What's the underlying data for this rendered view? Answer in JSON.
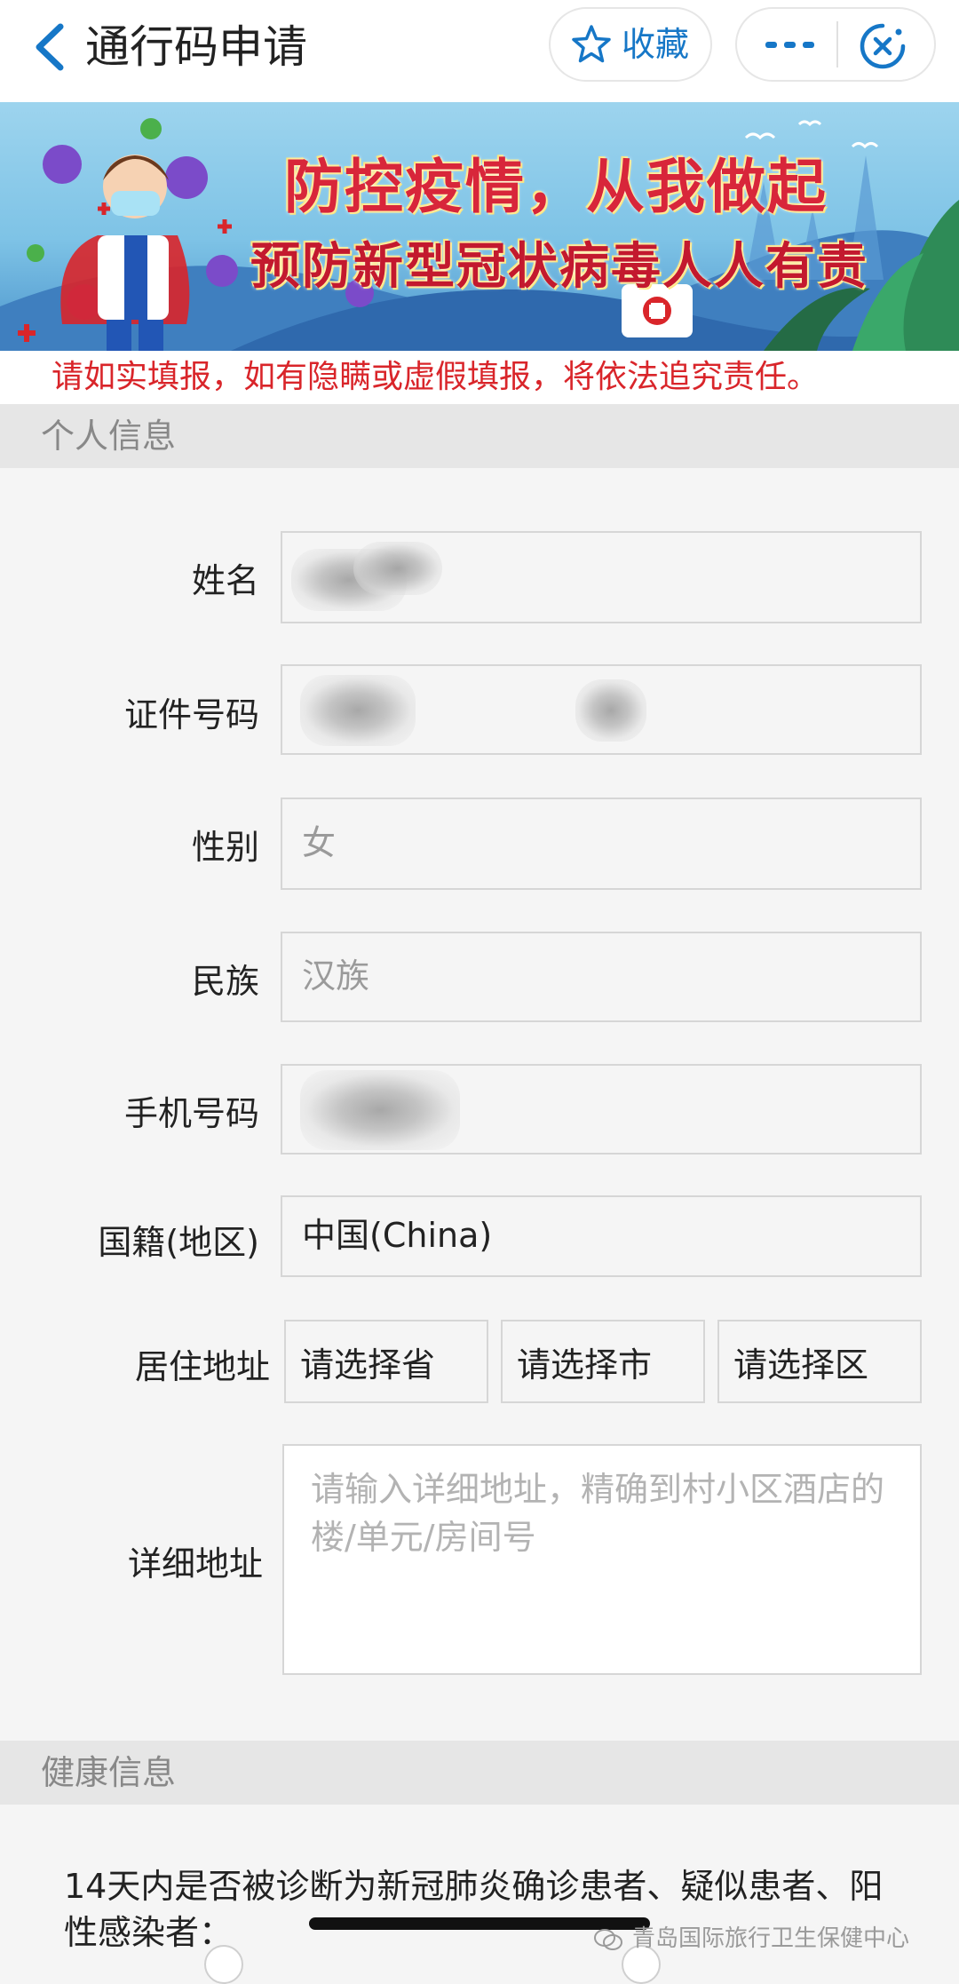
{
  "nav": {
    "title": "通行码申请",
    "favorite_label": "收藏",
    "icons": {
      "back": "chevron-left-icon",
      "favorite": "star-icon",
      "more": "more-dots-icon",
      "close": "close-circle-icon"
    },
    "accent": "#1677c7"
  },
  "banner": {
    "line1": "防控疫情，从我做起",
    "line2": "预防新型冠状病毒人人有责"
  },
  "warning": "请如实填报，如有隐瞒或虚假填报，将依法追究责任。",
  "sections": {
    "personal": "个人信息",
    "health": "健康信息"
  },
  "form": {
    "name": {
      "label": "姓名",
      "value": ""
    },
    "id_number": {
      "label": "证件号码",
      "value": ""
    },
    "gender": {
      "label": "性别",
      "value": "女"
    },
    "ethnicity": {
      "label": "民族",
      "value": "汉族"
    },
    "phone": {
      "label": "手机号码",
      "value": ""
    },
    "nationality": {
      "label": "国籍(地区)",
      "value": "中国(China)"
    },
    "address": {
      "label": "居住地址",
      "province_placeholder": "请选择省",
      "city_placeholder": "请选择市",
      "district_placeholder": "请选择区"
    },
    "detail_address": {
      "label": "详细地址",
      "placeholder": "请输入详细地址，精确到村小区酒店的楼/单元/房间号"
    }
  },
  "health": {
    "question": "14天内是否被诊断为新冠肺炎确诊患者、疑似患者、阳性感染者："
  },
  "watermark": "青岛国际旅行卫生保健中心",
  "colors": {
    "warning": "#d9252a",
    "section_bg": "#e6e6e6",
    "page_bg": "#f5f5f5"
  }
}
